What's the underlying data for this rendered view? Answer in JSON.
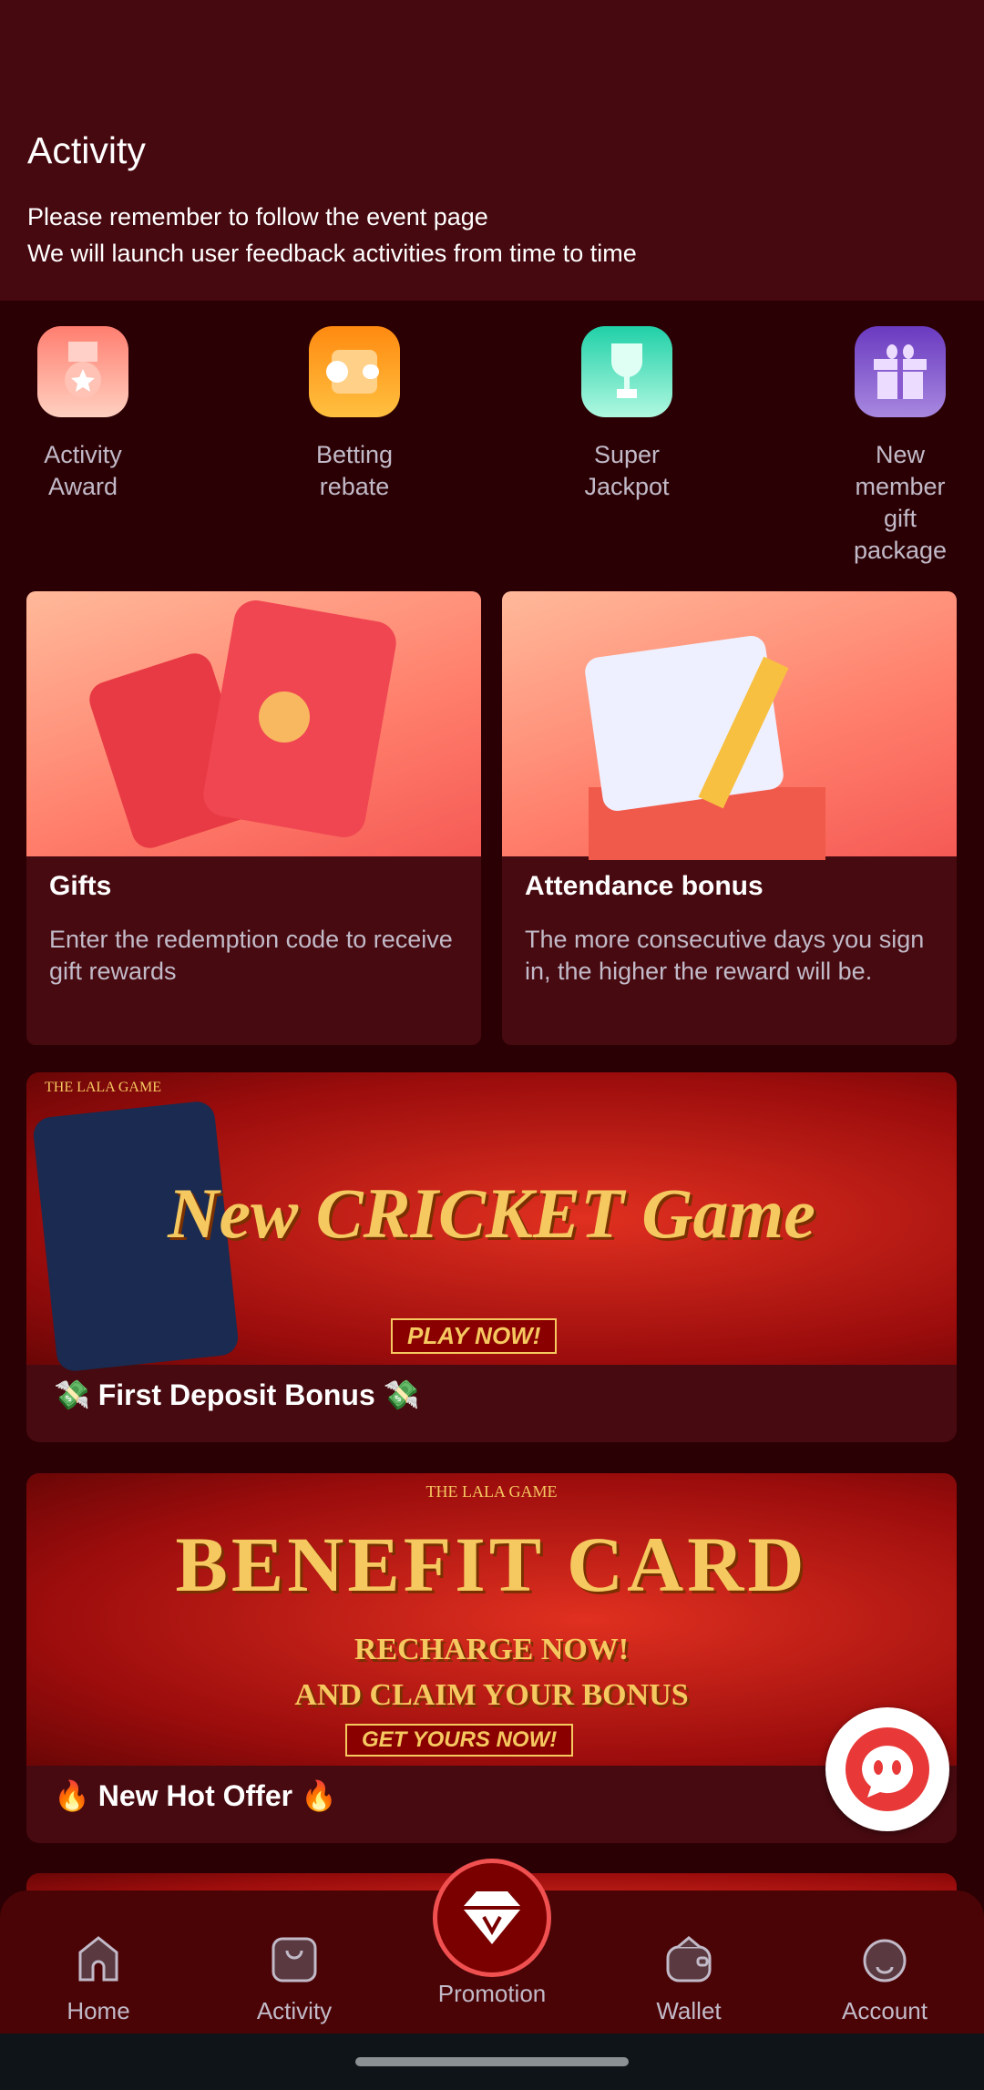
{
  "header": {
    "title": "Activity",
    "subtitle_lines": [
      "Please remember to follow the event page",
      "We will launch user feedback activities from time to time"
    ]
  },
  "shortcuts": [
    {
      "label": "Activity Award",
      "icon": "medal-icon",
      "color": "#ff8f7e"
    },
    {
      "label": "Betting rebate",
      "icon": "rebate-icon",
      "color": "#ffa020"
    },
    {
      "label": "Super Jackpot",
      "icon": "trophy-icon",
      "color": "#40dcb0"
    },
    {
      "label": "New member gift package",
      "icon": "gift-icon",
      "color": "#8a5ad0"
    }
  ],
  "cards": [
    {
      "title": "Gifts",
      "description": "Enter the redemption code to receive gift rewards"
    },
    {
      "title": "Attendance bonus",
      "description": "The more consecutive days you sign in, the higher the reward will be."
    }
  ],
  "banners": [
    {
      "label": "💸 First Deposit Bonus 💸",
      "brand": "THE LALA GAME",
      "headline": "New CRICKET Game",
      "cta": "PLAY NOW!"
    },
    {
      "label": "🔥 New Hot Offer 🔥",
      "brand": "THE LALA GAME",
      "headline": "BENEFIT CARD",
      "sub1": "RECHARGE NOW!",
      "sub2": "AND CLAIM YOUR BONUS",
      "cta": "GET YOURS NOW!"
    }
  ],
  "nav": [
    {
      "label": "Home"
    },
    {
      "label": "Activity"
    },
    {
      "label": "Promotion"
    },
    {
      "label": "Wallet"
    },
    {
      "label": "Account"
    }
  ]
}
